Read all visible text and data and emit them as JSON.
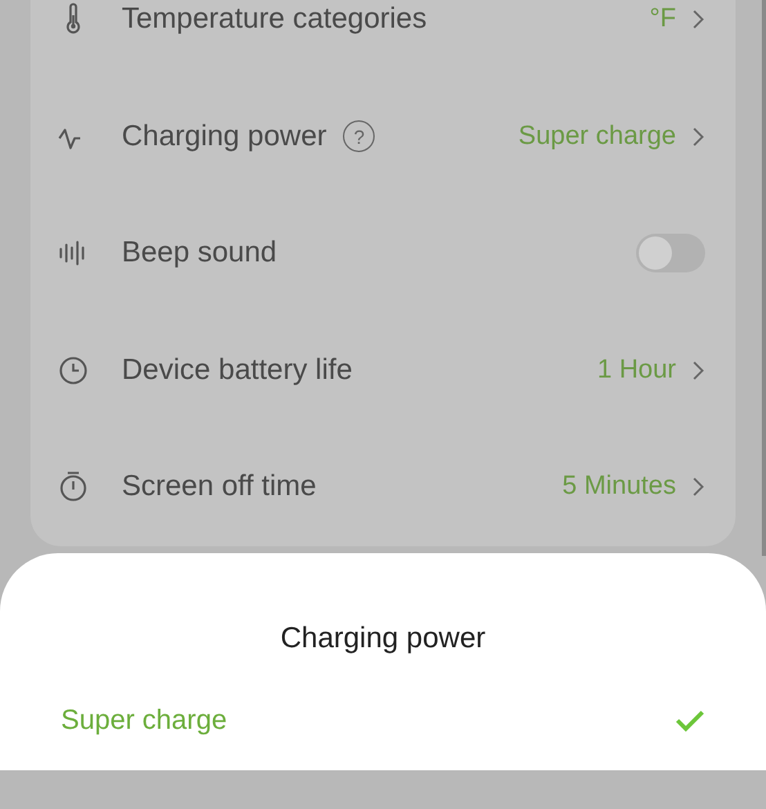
{
  "settings": [
    {
      "kind": "value",
      "label": "Temperature categories",
      "value": "°F"
    },
    {
      "kind": "value",
      "label": "Charging power",
      "help": "?",
      "value": "Super charge"
    },
    {
      "kind": "toggle",
      "label": "Beep sound",
      "on": false
    },
    {
      "kind": "value",
      "label": "Device battery life",
      "value": "1 Hour"
    },
    {
      "kind": "value",
      "label": "Screen off time",
      "value": "5 Minutes"
    }
  ],
  "sheet": {
    "title": "Charging power",
    "options": [
      {
        "label": "Super charge",
        "selected": true
      }
    ]
  }
}
